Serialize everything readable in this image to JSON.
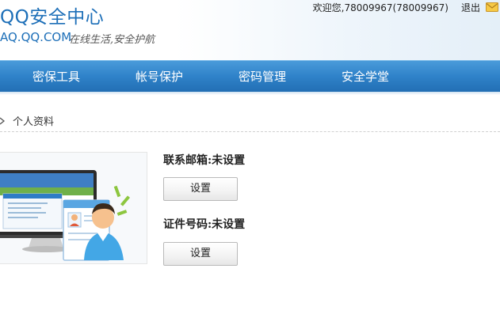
{
  "header": {
    "brand_title": "QQ安全中心",
    "brand_url": "AQ.QQ.COM",
    "slogan": "在线生活,安全护航",
    "welcome": "欢迎您,78009967(78009967)",
    "logout": "退出",
    "mail_icon": "mail-icon"
  },
  "nav": {
    "items": [
      {
        "label": "密保工具"
      },
      {
        "label": "帐号保护"
      },
      {
        "label": "密码管理"
      },
      {
        "label": "安全学堂"
      }
    ]
  },
  "breadcrumb": {
    "arrow_icon": "chevron-right-icon",
    "label": "个人资料"
  },
  "profile": {
    "email_label": "联系邮箱:",
    "email_value": "未设置",
    "email_button": "设置",
    "id_label": "证件号码:",
    "id_value": "未设置",
    "id_button": "设置"
  },
  "colors": {
    "brand_blue": "#1d6fb8",
    "nav_blue": "#2f82c9"
  }
}
